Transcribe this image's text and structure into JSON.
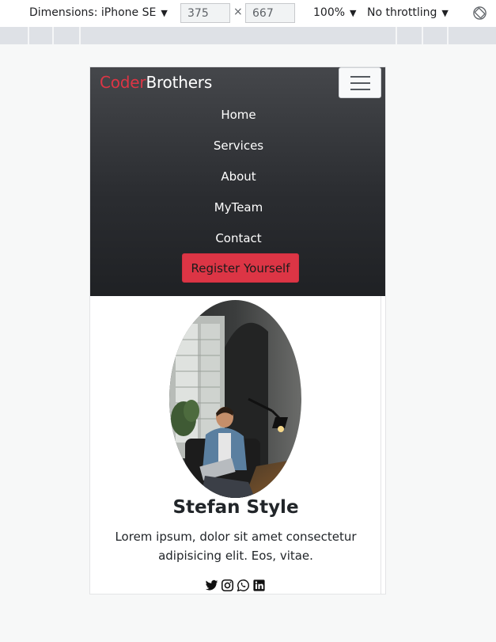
{
  "devtools": {
    "device_label": "Dimensions: iPhone SE",
    "width_value": "375",
    "height_value": "667",
    "times": "×",
    "zoom_label": "100%",
    "throttle_label": "No throttling",
    "caret": "▼"
  },
  "navbar": {
    "brand_part1": "Coder",
    "brand_part2": "Brothers",
    "links": [
      {
        "label": "Home"
      },
      {
        "label": "Services"
      },
      {
        "label": "About"
      },
      {
        "label": "MyTeam"
      },
      {
        "label": "Contact"
      }
    ],
    "register_label": "Register Yourself"
  },
  "member": {
    "name": "Stefan Style",
    "description": "Lorem ipsum, dolor sit amet consectetur adipisicing elit. Eos, vitae.",
    "social_icons": [
      "twitter-icon",
      "instagram-icon",
      "whatsapp-icon",
      "linkedin-icon"
    ]
  },
  "colors": {
    "brand_red": "#dc3545",
    "navbar_dark": "#2b2d31"
  }
}
